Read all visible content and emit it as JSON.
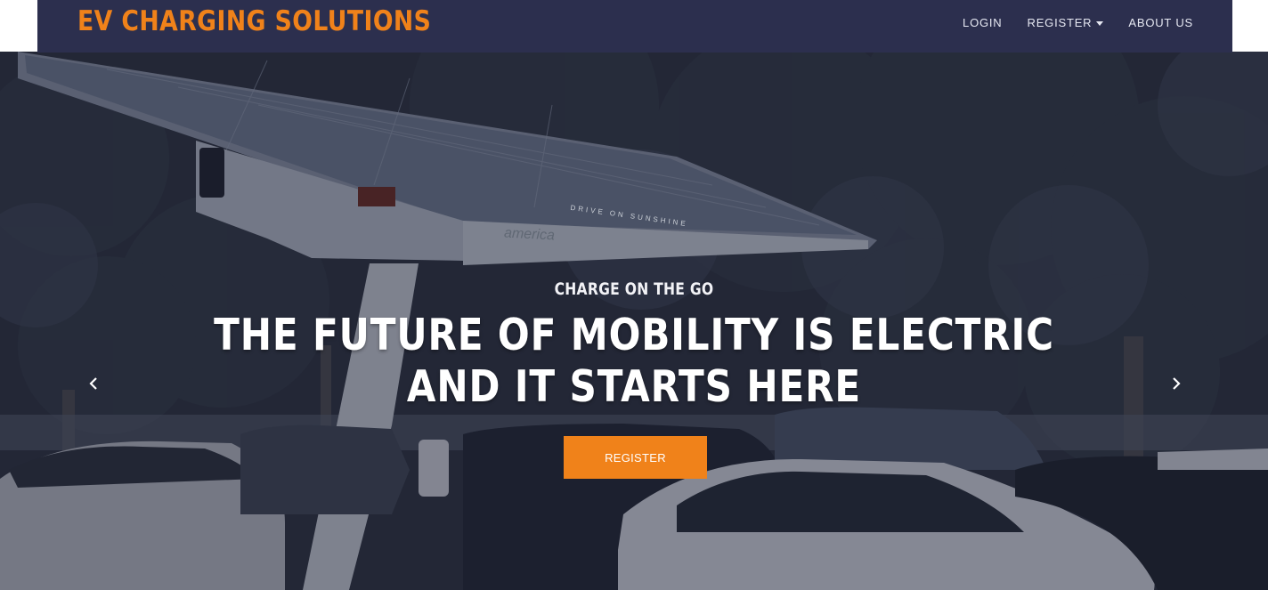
{
  "navbar": {
    "brand": "EV CHARGING SOLUTIONS",
    "links": [
      {
        "label": "LOGIN"
      },
      {
        "label": "REGISTER",
        "has_dropdown": true
      },
      {
        "label": "ABOUT US"
      }
    ]
  },
  "hero": {
    "eyebrow": "CHARGE ON THE GO",
    "headline_line1": "THE FUTURE OF MOBILITY IS ELECTRIC",
    "headline_line2": "AND IT STARTS HERE",
    "cta_label": "REGISTER",
    "panel_text": "DRIVE ON SUNSHINE",
    "canopy_brand": "america"
  },
  "icons": {
    "prev": "chevron-left-icon",
    "next": "chevron-right-icon",
    "dropdown": "caret-down-icon"
  },
  "colors": {
    "navbar_bg": "#2c2f4e",
    "brand": "#f0821a",
    "cta_bg": "#f0821a",
    "text_light": "#ffffff"
  }
}
